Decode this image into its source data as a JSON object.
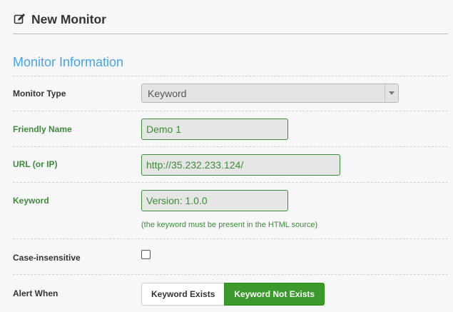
{
  "header": {
    "title": "New Monitor",
    "icon": "edit-icon"
  },
  "section": {
    "title": "Monitor Information"
  },
  "form": {
    "monitor_type": {
      "label": "Monitor Type",
      "value": "Keyword"
    },
    "friendly_name": {
      "label": "Friendly Name",
      "value": "Demo 1"
    },
    "url": {
      "label": "URL (or IP)",
      "value": "http://35.232.233.124/"
    },
    "keyword": {
      "label": "Keyword",
      "value": "Version: 1.0.0",
      "hint": "(the keyword must be present in the HTML source)"
    },
    "case_insensitive": {
      "label": "Case-insensitive",
      "checked": false
    },
    "alert_when": {
      "label": "Alert When",
      "options": [
        "Keyword Exists",
        "Keyword Not Exists"
      ],
      "selected": "Keyword Not Exists"
    }
  },
  "colors": {
    "accent_blue": "#4aa3df",
    "valid_green": "#3d8b37",
    "active_button": "#3c9a2c"
  }
}
